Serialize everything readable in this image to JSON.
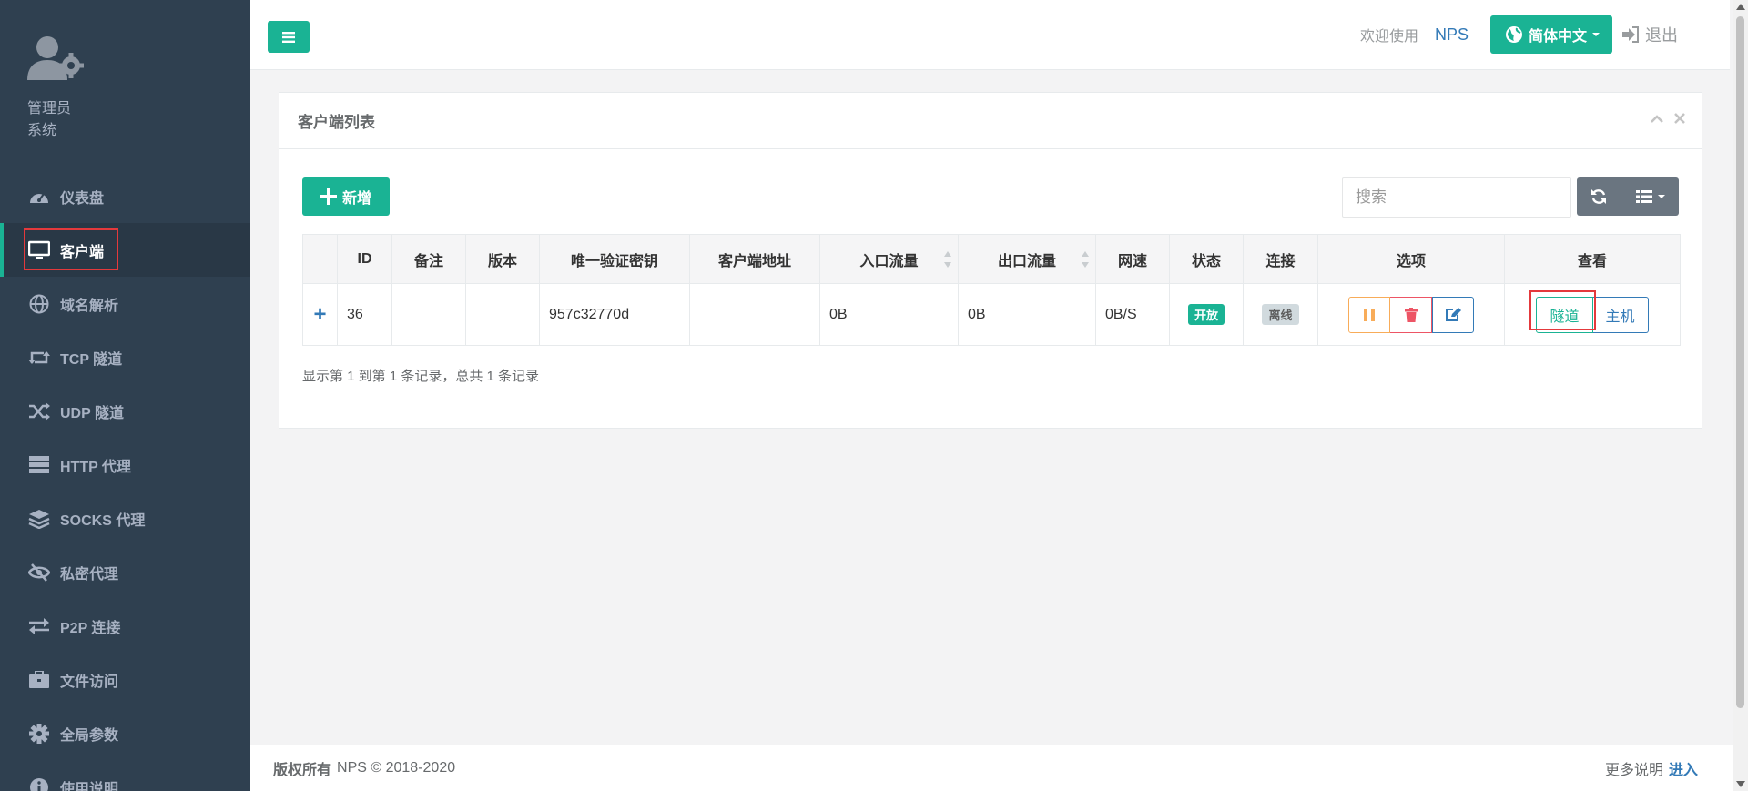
{
  "sidebar": {
    "profile": {
      "name": "管理员",
      "role": "系统"
    },
    "items": [
      {
        "label": "仪表盘",
        "icon": "dashboard-icon"
      },
      {
        "label": "客户端",
        "icon": "monitor-icon",
        "active": true
      },
      {
        "label": "域名解析",
        "icon": "globe-icon"
      },
      {
        "label": "TCP 隧道",
        "icon": "retweet-icon"
      },
      {
        "label": "UDP 隧道",
        "icon": "random-icon"
      },
      {
        "label": "HTTP 代理",
        "icon": "server-icon"
      },
      {
        "label": "SOCKS 代理",
        "icon": "layers-icon"
      },
      {
        "label": "私密代理",
        "icon": "eye-slash-icon"
      },
      {
        "label": "P2P 连接",
        "icon": "exchange-icon"
      },
      {
        "label": "文件访问",
        "icon": "briefcase-icon"
      },
      {
        "label": "全局参数",
        "icon": "gear-icon"
      },
      {
        "label": "使用说明",
        "icon": "info-icon"
      }
    ]
  },
  "header": {
    "welcome": "欢迎使用",
    "brand": "NPS",
    "language": "简体中文",
    "logout": "退出"
  },
  "panel": {
    "title": "客户端列表",
    "add_button": "新增",
    "search_placeholder": "搜索",
    "columns": [
      "ID",
      "备注",
      "版本",
      "唯一验证密钥",
      "客户端地址",
      "入口流量",
      "出口流量",
      "网速",
      "状态",
      "连接",
      "选项",
      "查看"
    ],
    "rows": [
      {
        "id": "36",
        "remark": "",
        "version": "",
        "vkey": "957c32770d",
        "addr": "",
        "in_flow": "0B",
        "out_flow": "0B",
        "rate": "0B/S",
        "status": "开放",
        "connection": "离线",
        "view_tunnel": "隧道",
        "view_host": "主机"
      }
    ],
    "pager_info": "显示第 1 到第 1 条记录，总共 1 条记录"
  },
  "footer": {
    "copyright_label": "版权所有",
    "copyright_text": "NPS © 2018-2020",
    "more_label": "更多说明",
    "more_link": "进入"
  },
  "colors": {
    "sidebar_bg": "#2f4050",
    "primary": "#1ab394",
    "link": "#337ab7",
    "highlight": "#e4393c",
    "warning": "#f8ac59",
    "danger": "#ed5565"
  }
}
